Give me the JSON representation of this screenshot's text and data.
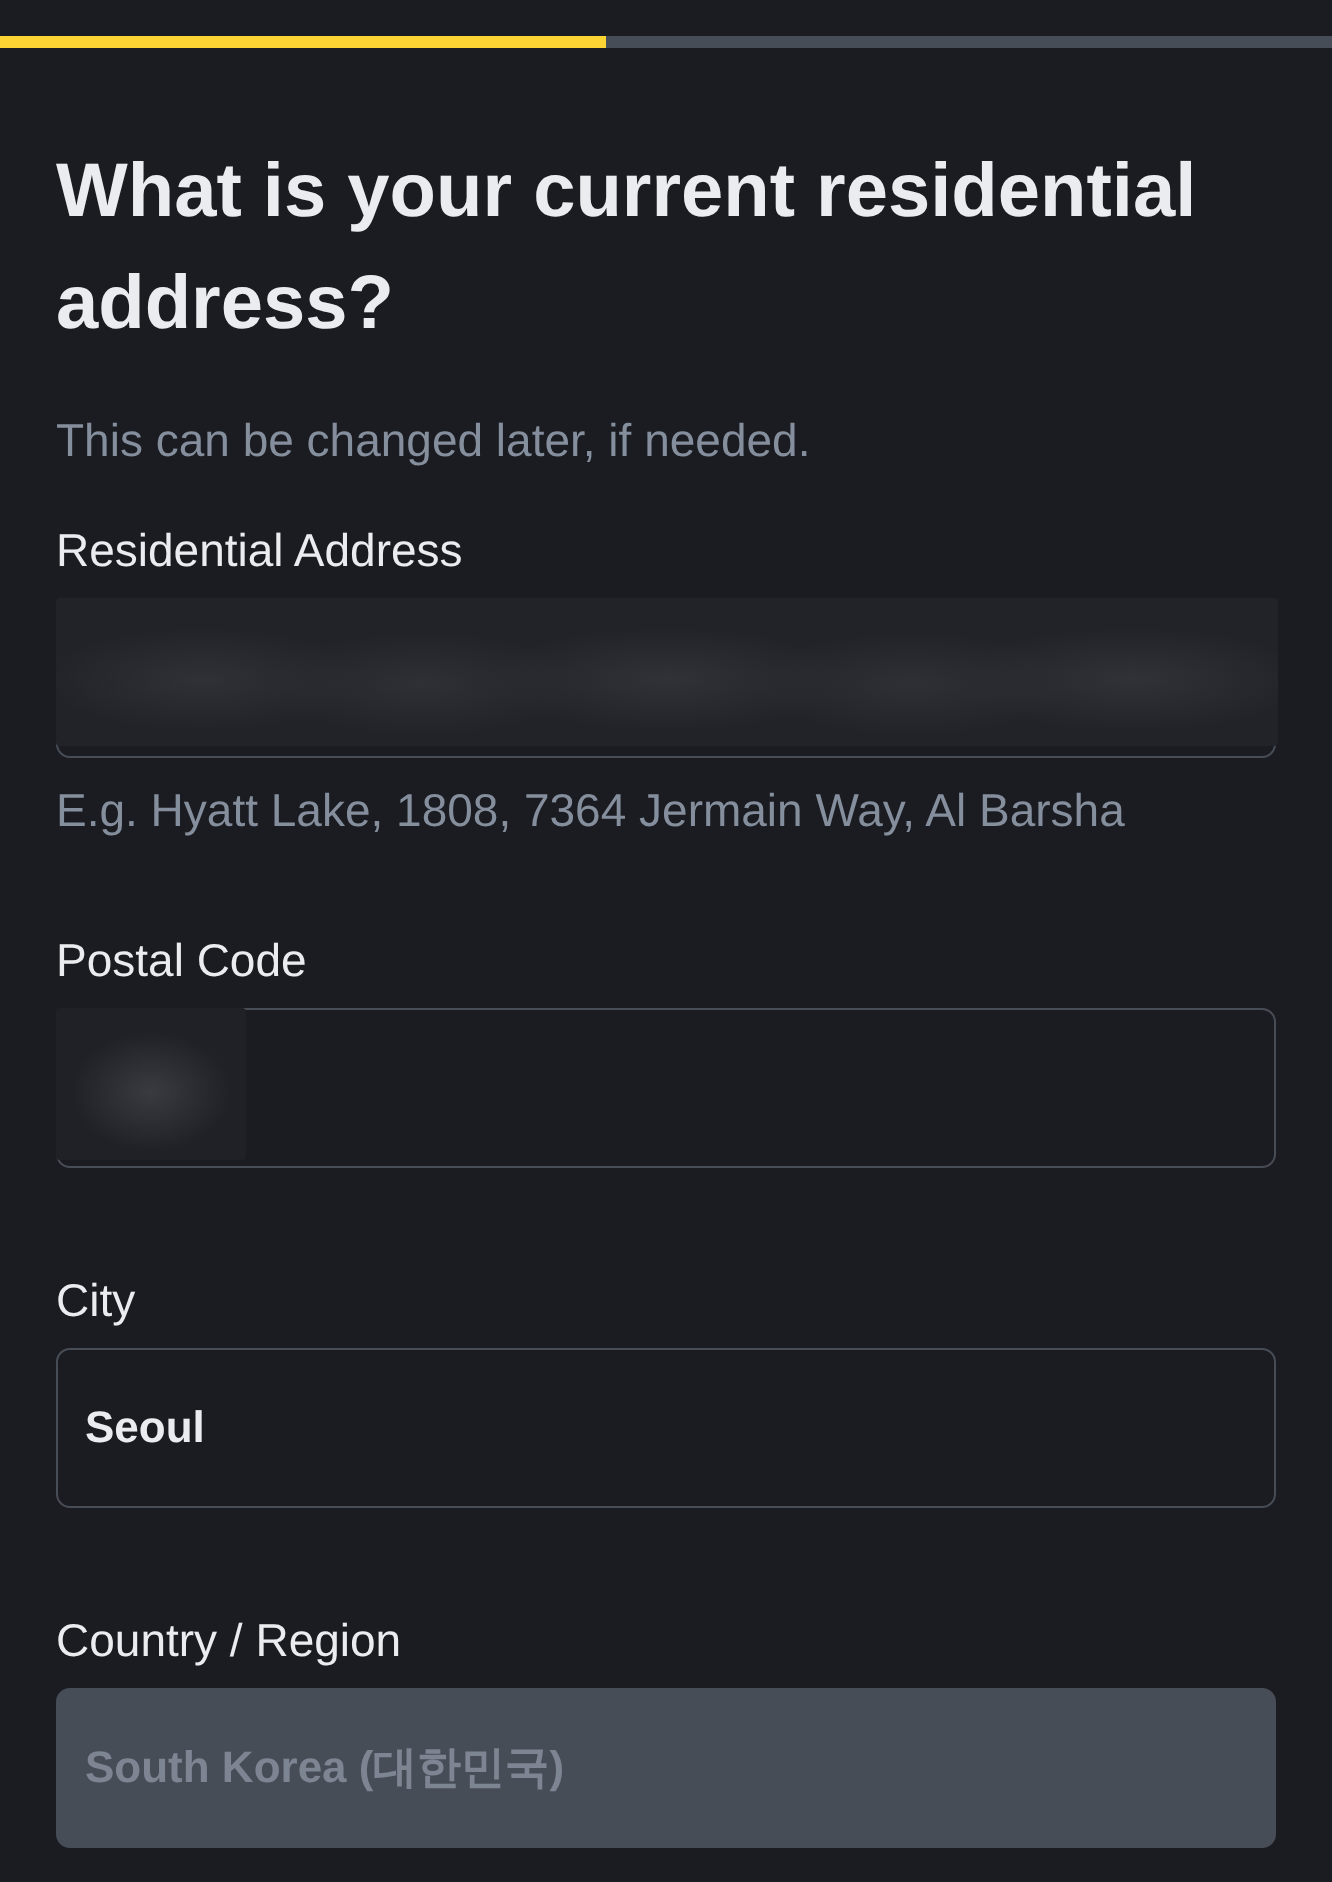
{
  "progress": {
    "level": 0.455
  },
  "title": "What is your current residential address?",
  "subtitle": "This can be changed later, if needed.",
  "fields": [
    {
      "kind": "address",
      "label": "Residential Address",
      "redacted": true,
      "hint": "E.g. Hyatt Lake, 1808, 7364 Jermain Way, Al Barsha",
      "disabled": false
    },
    {
      "kind": "text",
      "label": "Postal Code",
      "redacted": true,
      "disabled": false
    },
    {
      "kind": "text",
      "label": "City",
      "value": "Seoul",
      "redacted": false,
      "disabled": false
    },
    {
      "kind": "text",
      "label": "Country / Region",
      "value": "South Korea (대한민국)",
      "redacted": false,
      "disabled": true
    }
  ]
}
